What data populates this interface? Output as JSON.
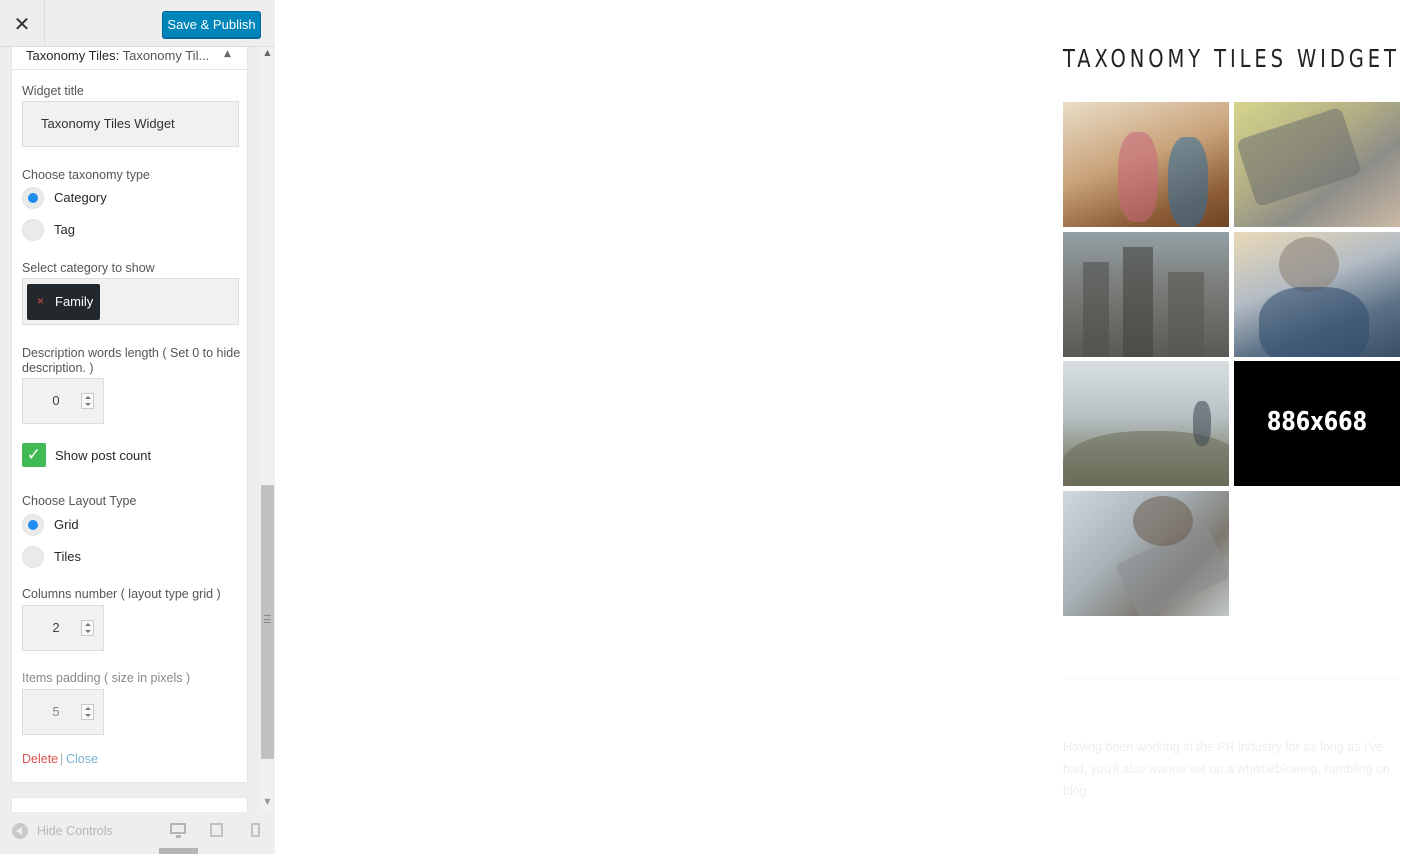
{
  "topbar": {
    "close_glyph": "✕",
    "save_label": "Save & Publish"
  },
  "widget": {
    "head_title": "Taxonomy Tiles:",
    "head_sub": "Taxonomy Til...",
    "toggle_glyph": "▲",
    "title_label": "Widget title",
    "title_value": "Taxonomy Tiles Widget",
    "taxonomy_label": "Choose taxonomy type",
    "taxonomy_options": [
      {
        "label": "Category",
        "selected": true
      },
      {
        "label": "Tag",
        "selected": false
      }
    ],
    "category_label": "Select category to show",
    "category_tag": "Family",
    "category_tag_remove": "×",
    "desc_label": "Description words length ( Set 0 to hide description. )",
    "desc_value": "0",
    "show_count_label": "Show post count",
    "show_count_checked": true,
    "check_glyph": "✓",
    "layout_label": "Choose Layout Type",
    "layout_options": [
      {
        "label": "Grid",
        "selected": true
      },
      {
        "label": "Tiles",
        "selected": false
      }
    ],
    "columns_label": "Columns number ( layout type grid )",
    "columns_value": "2",
    "padding_label": "Items padding ( size in pixels )",
    "padding_value": "5",
    "delete_label": "Delete",
    "separator": "|",
    "close_label": "Close"
  },
  "footer": {
    "hide_label": "Hide Controls"
  },
  "scrollbar": {
    "up_glyph": "▲",
    "down_glyph": "▼"
  },
  "preview": {
    "title": "TAXONOMY TILES WIDGET",
    "tiles": [
      {
        "name": "family-photo"
      },
      {
        "name": "laptop-photo"
      },
      {
        "name": "city-photo"
      },
      {
        "name": "man-phone-photo"
      },
      {
        "name": "hikers-photo"
      },
      {
        "name": "placeholder",
        "text": "886x668"
      },
      {
        "name": "laptop-hands-photo"
      }
    ],
    "faded_text": "Having been working in the PR industry for as long as I've had, you'll also wanna set up a whistleblowing, rambling on blog"
  }
}
